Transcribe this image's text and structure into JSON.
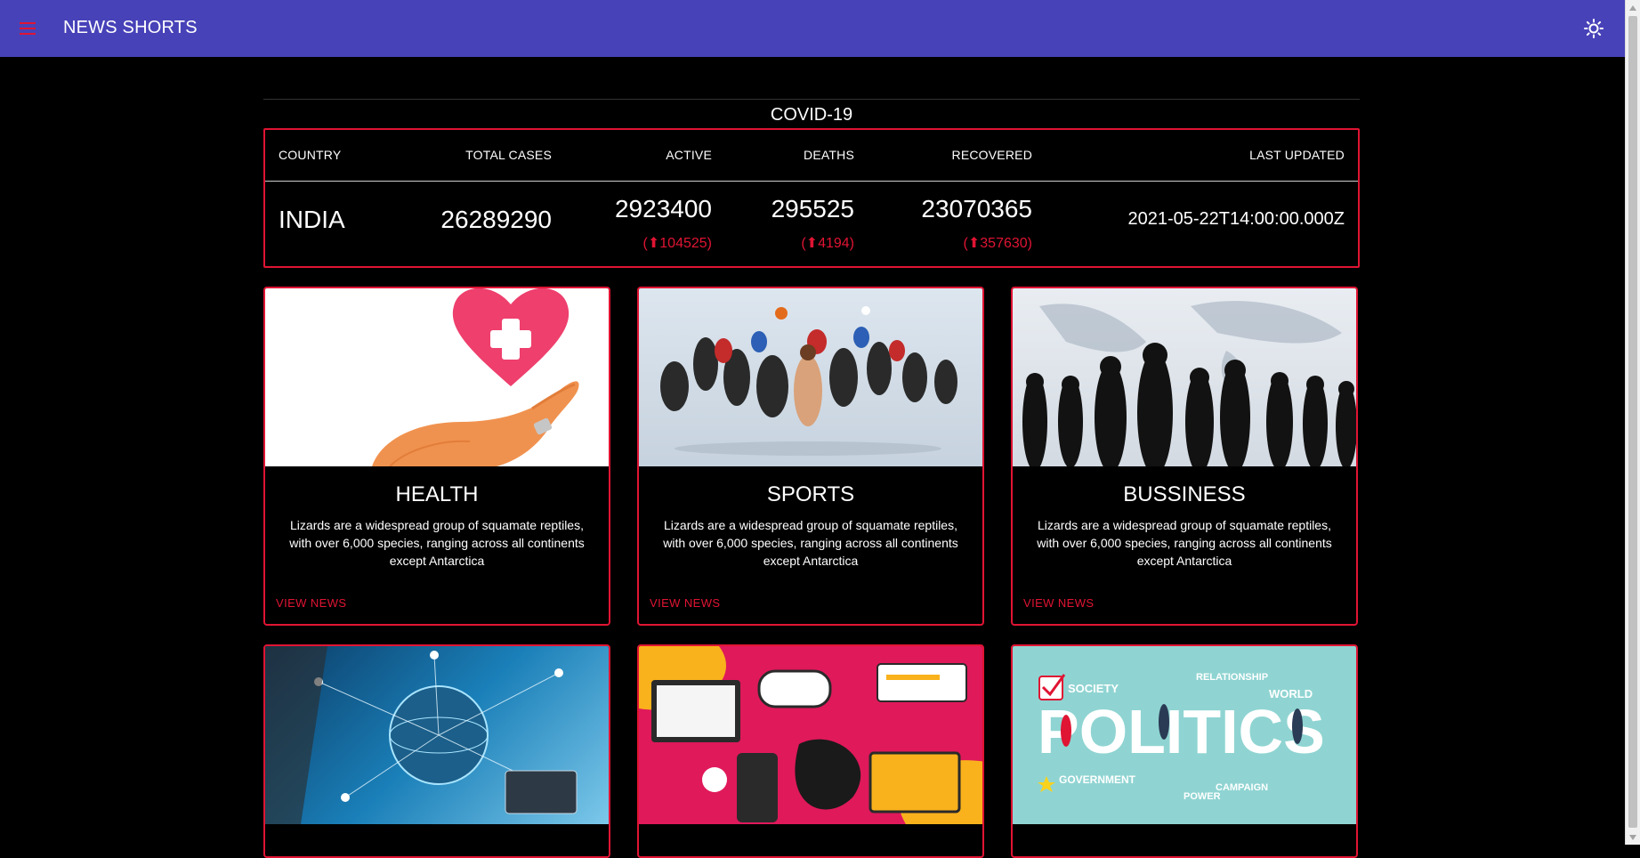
{
  "appbar": {
    "title": "NEWS SHORTS",
    "menu_icon": "hamburger-menu-icon",
    "theme_icon": "sun-brightness-icon"
  },
  "covid": {
    "title": "COVID-19",
    "headers": {
      "country": "COUNTRY",
      "total": "TOTAL CASES",
      "active": "ACTIVE",
      "deaths": "DEATHS",
      "recovered": "RECOVERED",
      "updated": "LAST UPDATED"
    },
    "row": {
      "country": "INDIA",
      "total": "26289290",
      "active": "2923400",
      "active_delta": "(⬆104525)",
      "deaths": "295525",
      "deaths_delta": "(⬆4194)",
      "recovered": "23070365",
      "recovered_delta": "(⬆357630)",
      "updated": "2021-05-22T14:00:00.000Z"
    }
  },
  "categories": [
    {
      "title": "HEALTH",
      "desc": "Lizards are a widespread group of squamate reptiles, with over 6,000 species, ranging across all continents except Antarctica",
      "link": "VIEW NEWS"
    },
    {
      "title": "SPORTS",
      "desc": "Lizards are a widespread group of squamate reptiles, with over 6,000 species, ranging across all continents except Antarctica",
      "link": "VIEW NEWS"
    },
    {
      "title": "BUSSINESS",
      "desc": "Lizards are a widespread group of squamate reptiles, with over 6,000 species, ranging across all continents except Antarctica",
      "link": "VIEW NEWS"
    }
  ],
  "politics_words": {
    "big": "POLITICS",
    "society": "SOCIETY",
    "relationship": "RELATIONSHIP",
    "world": "WORLD",
    "government": "GOVERNMENT",
    "campaign": "CAMPAIGN",
    "power": "POWER"
  },
  "colors": {
    "appbar": "#4742b8",
    "accent": "#e01433",
    "background": "#000000"
  }
}
